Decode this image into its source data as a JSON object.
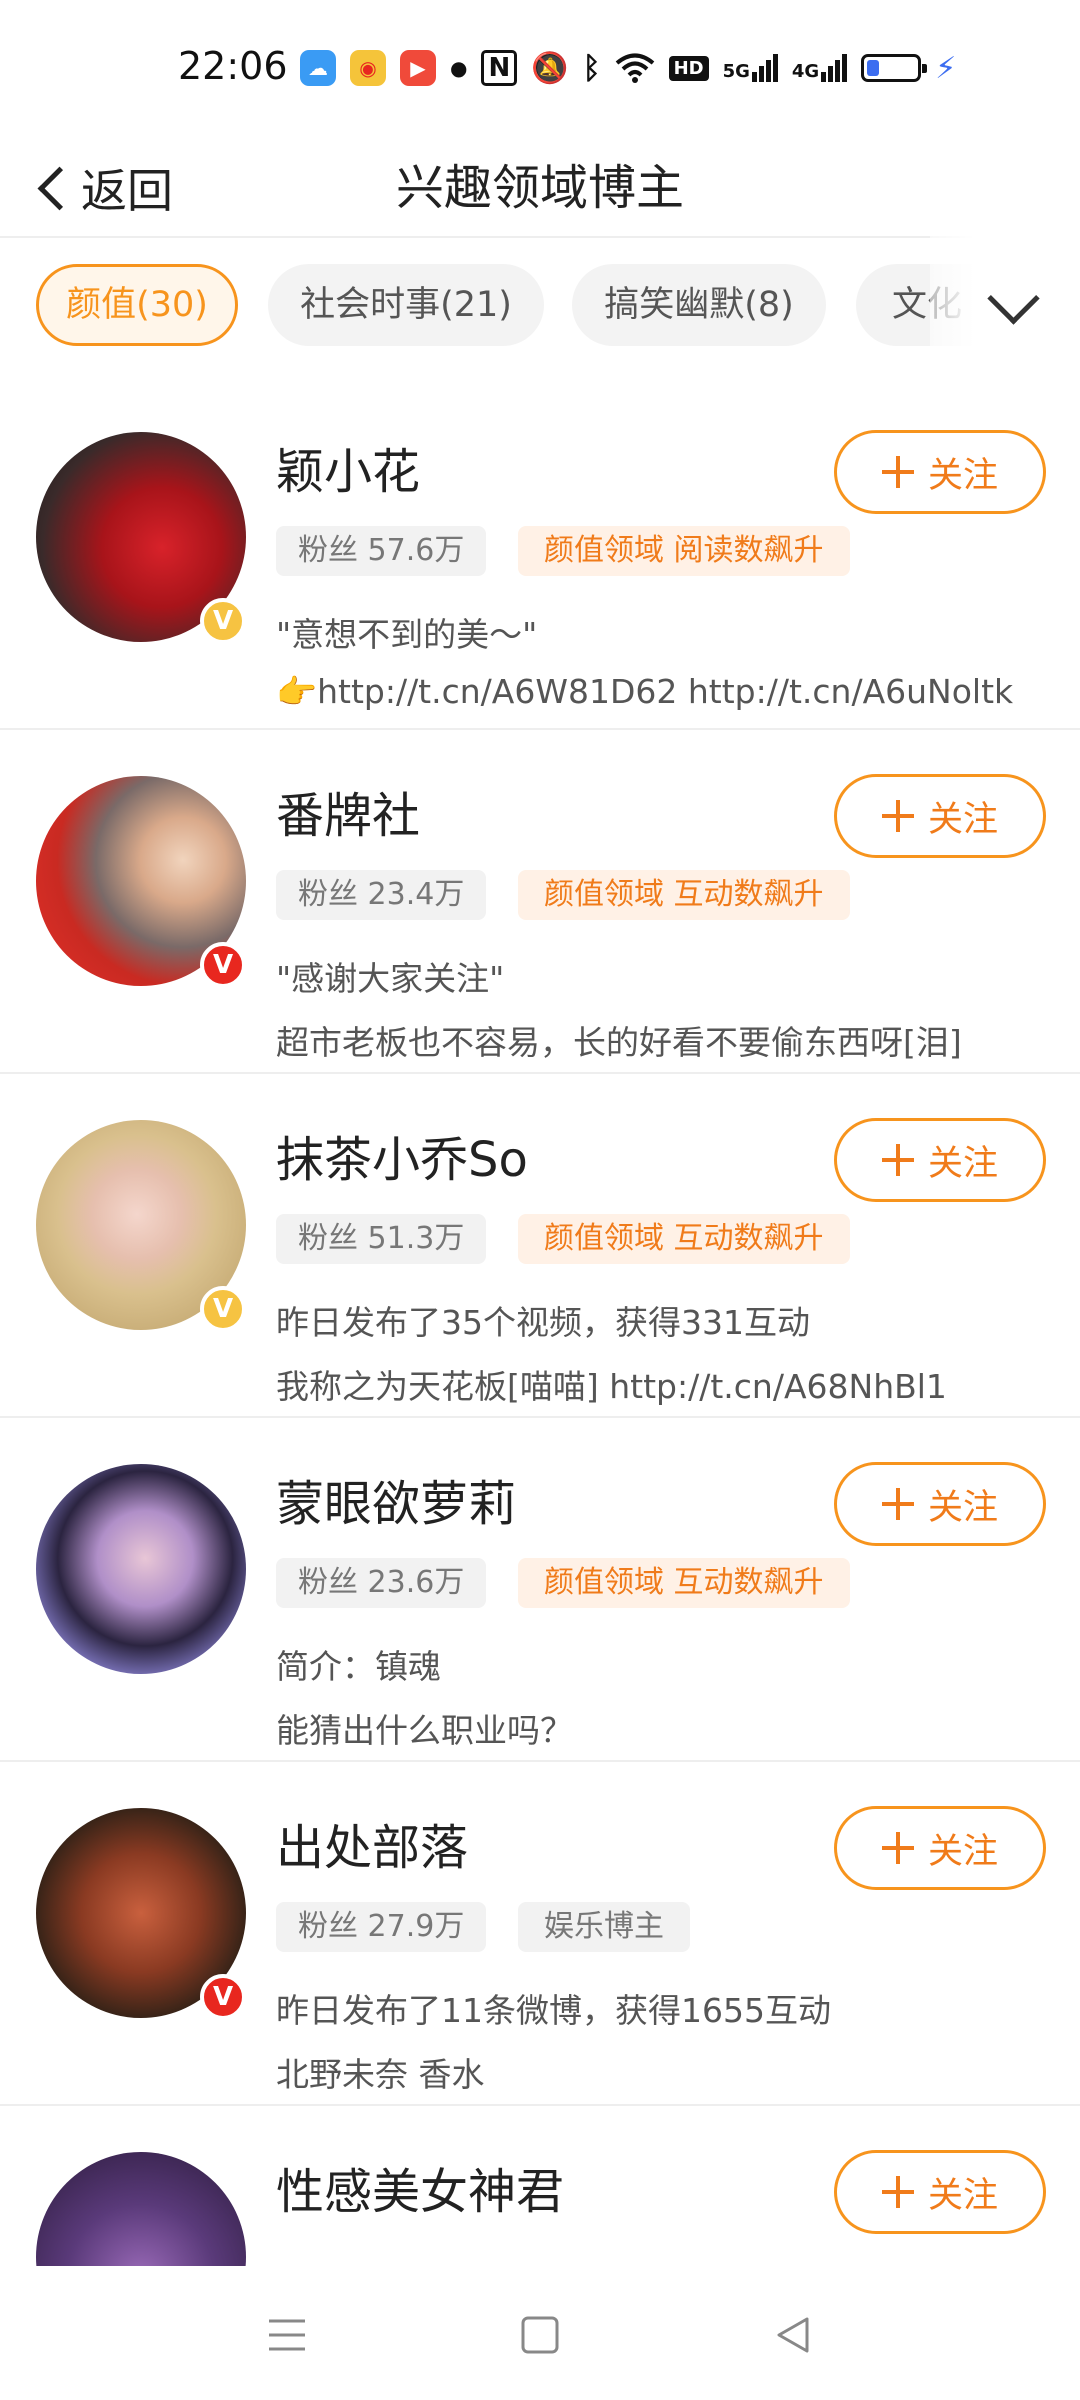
{
  "status_bar": {
    "time": "22:06",
    "network_5g": "5G",
    "network_4g": "4G",
    "hd_label": "HD",
    "battery_level": 0.25,
    "icons": [
      "weather-app-icon",
      "weibo-app-icon",
      "video-app-icon",
      "dot-icon",
      "nfc-icon",
      "mute-icon",
      "bluetooth-icon",
      "wifi-icon",
      "hd-icon",
      "signal-5g-icon",
      "signal-4g-icon",
      "battery-icon",
      "charging-icon"
    ]
  },
  "header": {
    "back_label": "返回",
    "title": "兴趣领域博主"
  },
  "chips": [
    {
      "label": "颜值(30)",
      "active": true
    },
    {
      "label": "社会时事(21)",
      "active": false
    },
    {
      "label": "搞笑幽默(8)",
      "active": false
    },
    {
      "label": "文化",
      "active": false
    }
  ],
  "follow_label": "关注",
  "bloggers": [
    {
      "name": "颖小花",
      "fans": "粉丝 57.6万",
      "tag": "颜值领域 阅读数飙升",
      "tag_style": "orange",
      "line1": "\"意想不到的美～\"",
      "line2": "👉http://t.cn/A6W81D62 http://t.cn/A6uNoltk",
      "verified": "gold"
    },
    {
      "name": "番牌社",
      "fans": "粉丝 23.4万",
      "tag": "颜值领域 互动数飙升",
      "tag_style": "orange",
      "line1": "\"感谢大家关注\"",
      "line2": "超市老板也不容易，长的好看不要偷东西呀[泪]",
      "verified": "red"
    },
    {
      "name": "抹茶小乔So",
      "fans": "粉丝 51.3万",
      "tag": "颜值领域 互动数飙升",
      "tag_style": "orange",
      "line1": "昨日发布了35个视频，获得331互动",
      "line2": "我称之为天花板[喵喵] http://t.cn/A68NhBl1",
      "verified": "gold"
    },
    {
      "name": "蒙眼欲萝莉",
      "fans": "粉丝 23.6万",
      "tag": "颜值领域 互动数飙升",
      "tag_style": "orange",
      "line1": "简介：镇魂",
      "line2": "能猜出什么职业吗？",
      "verified": ""
    },
    {
      "name": "出处部落",
      "fans": "粉丝 27.9万",
      "tag": "娱乐博主",
      "tag_style": "grey",
      "line1": "昨日发布了11条微博，获得1655互动",
      "line2": "北野未奈 香水",
      "verified": "red"
    },
    {
      "name": "性感美女神君",
      "fans": "",
      "tag": "",
      "tag_style": "orange",
      "line1": "",
      "line2": "",
      "verified": ""
    }
  ],
  "colors": {
    "accent": "#f7941d",
    "accent_text": "#f07b1a",
    "tag_orange_bg": "#fff1e6",
    "verified_gold": "#f6c342",
    "verified_red": "#e8271f"
  },
  "nav": [
    "menu-icon",
    "home-square-icon",
    "back-triangle-icon"
  ]
}
